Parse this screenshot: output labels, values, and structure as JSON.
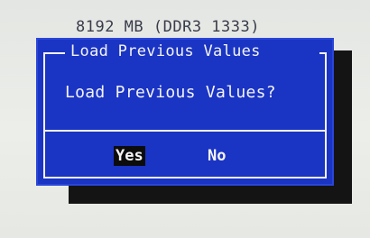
{
  "status": {
    "memory_line": "8192 MB (DDR3 1333)"
  },
  "dialog": {
    "title": "Load Previous Values",
    "message": "Load Previous Values?",
    "buttons": {
      "yes": "Yes",
      "no": "No"
    },
    "selected": "yes"
  },
  "colors": {
    "dialog_background": "#1a34c4",
    "text": "#f4f4f4",
    "selection_background": "#0c0c0c",
    "screen_background": "#e9ebe8"
  }
}
